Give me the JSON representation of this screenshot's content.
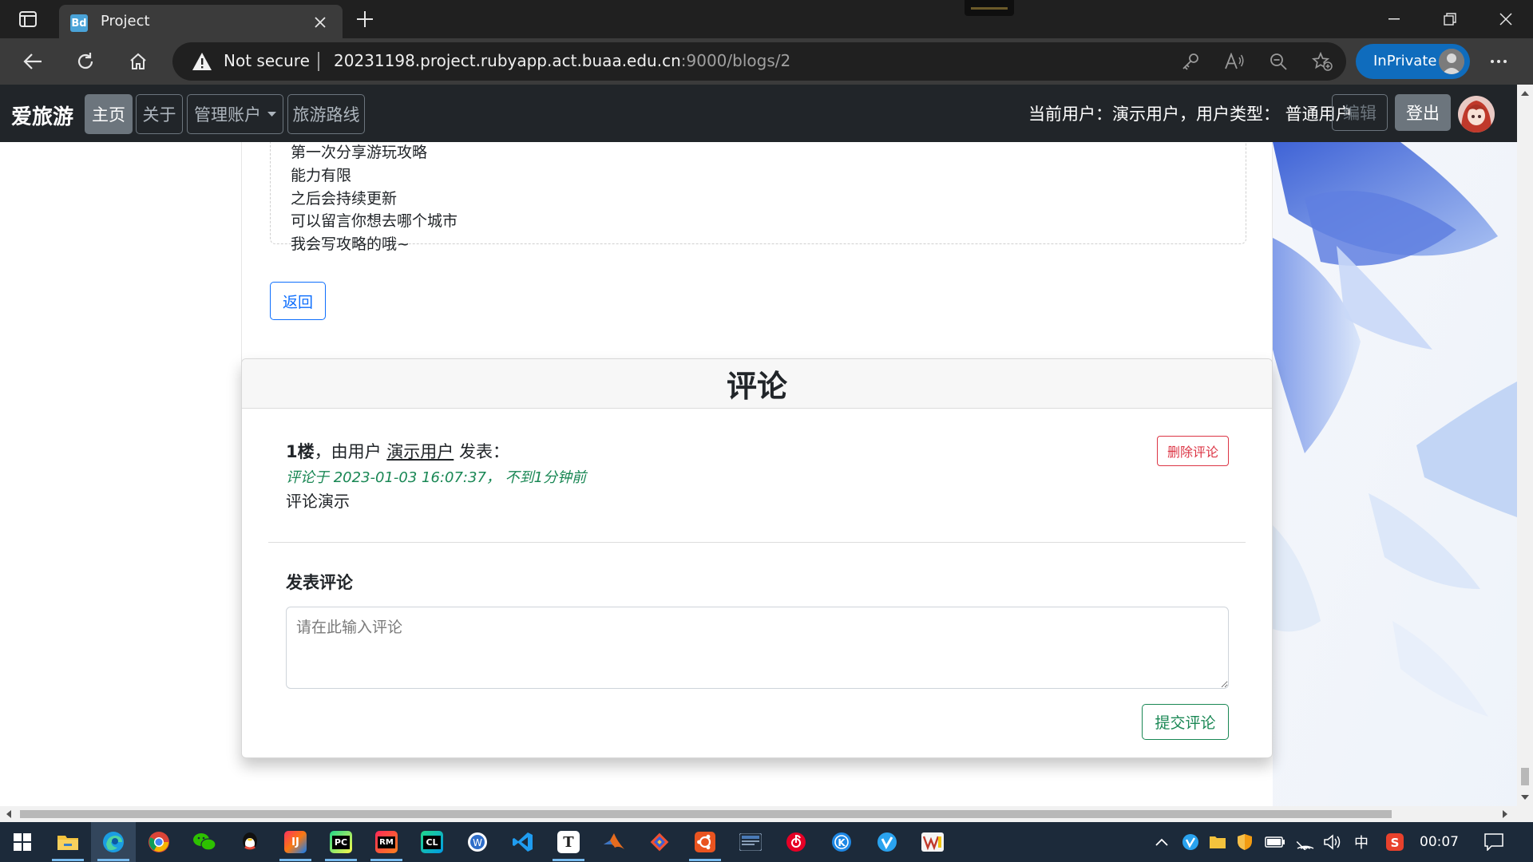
{
  "browser": {
    "tab": {
      "favicon_text": "Bd",
      "title": "Project"
    },
    "address": {
      "security_label": "Not secure",
      "url_host": "20231198.project.rubyapp.act.buaa.edu.cn",
      "url_path": ":9000/blogs/2"
    },
    "inprivate_label": "InPrivate"
  },
  "site": {
    "brand": "爱旅游",
    "nav": {
      "home": "主页",
      "about": "关于",
      "accounts": "管理账户",
      "routes": "旅游路线"
    },
    "user_info": "当前用户：演示用户，用户类型： 普通用户",
    "edit_label": "编辑",
    "logout_label": "登出"
  },
  "blog": {
    "body_lines": [
      "第一次分享游玩攻略",
      "能力有限",
      "之后会持续更新",
      "可以留言你想去哪个城市",
      "我会写攻略的哦~"
    ],
    "back_label": "返回"
  },
  "comments": {
    "title": "评论",
    "items": [
      {
        "floor": "1楼",
        "by_prefix": "，由用户 ",
        "author": "演示用户",
        "by_suffix": " 发表：",
        "meta": "评论于 2023-01-03 16:07:37， 不到1分钟前",
        "text": "评论演示",
        "delete_label": "删除评论"
      }
    ],
    "form": {
      "title": "发表评论",
      "placeholder": "请在此输入评论",
      "submit_label": "提交评论"
    }
  },
  "taskbar": {
    "apps": [
      "start",
      "file-explorer",
      "edge",
      "chrome",
      "wechat",
      "qq",
      "intellij-idea",
      "pycharm",
      "rubymine",
      "clion",
      "wps-writer",
      "vscode",
      "typora",
      "matlab",
      "git",
      "ubuntu",
      "mysql-workbench",
      "netease-music",
      "kugou",
      "tim",
      "wps"
    ],
    "tray_ime": "中",
    "time": "00:07"
  }
}
